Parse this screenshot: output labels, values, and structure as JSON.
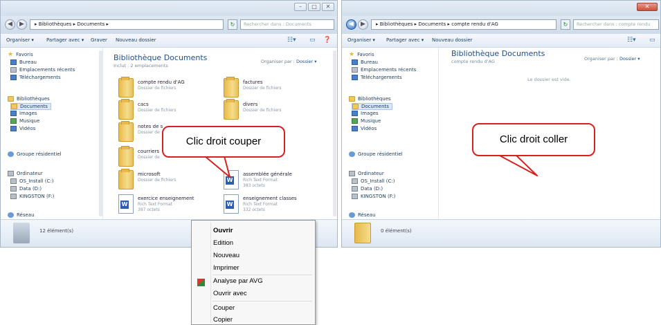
{
  "window1": {
    "controls": [
      "–",
      "□",
      "✕"
    ],
    "address": "▸ Bibliothèques ▸ Documents ▸",
    "search_placeholder": "Rechercher dans : Documents",
    "toolbar": {
      "organize": "Organiser ▾",
      "share": "Partager avec ▾",
      "burn": "Graver",
      "new_folder": "Nouveau dossier"
    },
    "nav": {
      "favorites": "Favoris",
      "desktop": "Bureau",
      "recent": "Emplacements récents",
      "downloads": "Téléchargements",
      "libraries": "Bibliothèques",
      "documents": "Documents",
      "images": "Images",
      "music": "Musique",
      "videos": "Vidéos",
      "homegroup": "Groupe résidentiel",
      "computer": "Ordinateur",
      "os": "OS_Install (C:)",
      "data": "Data (D:)",
      "kingston": "KINGSTON (F:)",
      "network": "Réseau"
    },
    "library_title": "Bibliothèque Documents",
    "library_sub": "Inclut : 2 emplacements",
    "arrange_label": "Organiser par :",
    "arrange_value": "Dossier ▾",
    "files": [
      {
        "name": "compte rendu d'AG",
        "type": "Dossier de fichiers",
        "size": ""
      },
      {
        "name": "factures",
        "type": "Dossier de fichiers",
        "size": ""
      },
      {
        "name": "cacs",
        "type": "Dossier de fichiers",
        "size": ""
      },
      {
        "name": "divers",
        "type": "Dossier de fichiers",
        "size": ""
      },
      {
        "name": "notes de s",
        "type": "Dossier de",
        "size": ""
      },
      {
        "name": "courriers",
        "type": "Dossier de",
        "size": ""
      },
      {
        "name": "microsoft",
        "type": "Dossier de fichiers",
        "size": ""
      },
      {
        "name": "assemblée générale",
        "type": "Rich Text Format",
        "size": "383 octets"
      },
      {
        "name": "exercice enseignement",
        "type": "Rich Text Format",
        "size": "387 octets"
      },
      {
        "name": "enseignement classes",
        "type": "Rich Text Format",
        "size": "332 octets"
      }
    ],
    "status": "12 élément(s)"
  },
  "window2": {
    "address": "▸ Bibliothèques ▸ Documents ▸ compte rendu d'AG",
    "search_placeholder": "Rechercher dans : compte rendu",
    "toolbar": {
      "organize": "Organiser ▾",
      "share": "Partager avec ▾",
      "new_folder": "Nouveau dossier"
    },
    "nav": {
      "favorites": "Favoris",
      "desktop": "Bureau",
      "recent": "Emplacements récents",
      "downloads": "Téléchargements",
      "libraries": "Bibliothèques",
      "documents": "Documents",
      "images": "Images",
      "music": "Musique",
      "videos": "Vidéos",
      "homegroup": "Groupe résidentiel",
      "computer": "Ordinateur",
      "os": "OS_Install (C:)",
      "data": "Data (D:)",
      "kingston": "KINGSTON (F:)",
      "network": "Réseau"
    },
    "library_title": "Bibliothèque Documents",
    "library_sub": "compte rendu d'AG",
    "arrange_label": "Organiser par :",
    "arrange_value": "Dossier ▾",
    "empty_text": "Le dossier est vide.",
    "status": "0 élément(s)"
  },
  "callouts": {
    "cut": "Clic droit couper",
    "paste": "Clic droit coller"
  },
  "context_menu": {
    "items": [
      "Ouvrir",
      "Edition",
      "Nouveau",
      "Imprimer",
      "Analyse par AVG",
      "Ouvrir avec",
      "Couper",
      "Copier"
    ]
  },
  "colors": {
    "callout_border": "#d92020",
    "library_title": "#1e4e8c",
    "nav_selected": "#dbe8f8"
  }
}
